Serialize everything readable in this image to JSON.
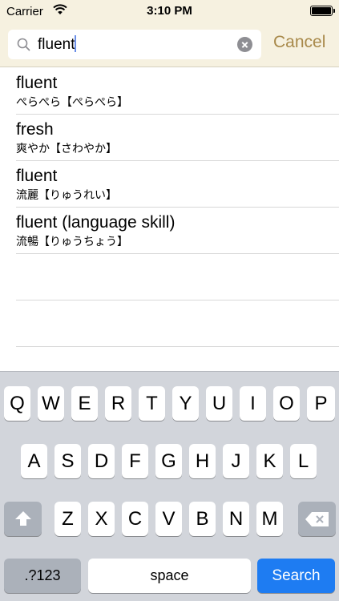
{
  "status_bar": {
    "carrier": "Carrier",
    "time": "3:10 PM",
    "wifi_icon": "wifi-icon",
    "battery_level": 1.0
  },
  "search": {
    "query": "fluent",
    "cancel_label": "Cancel"
  },
  "results": [
    {
      "english": "fluent",
      "japanese": "ぺらぺら【ぺらぺら】"
    },
    {
      "english": "fresh",
      "japanese": "爽やか【さわやか】"
    },
    {
      "english": "fluent",
      "japanese": "流麗【りゅうれい】"
    },
    {
      "english": "fluent (language skill)",
      "japanese": "流暢【りゅうちょう】"
    }
  ],
  "keyboard": {
    "row1": [
      "Q",
      "W",
      "E",
      "R",
      "T",
      "Y",
      "U",
      "I",
      "O",
      "P"
    ],
    "row2": [
      "A",
      "S",
      "D",
      "F",
      "G",
      "H",
      "J",
      "K",
      "L"
    ],
    "row3": [
      "Z",
      "X",
      "C",
      "V",
      "B",
      "N",
      "M"
    ],
    "numbers_label": ".?123",
    "space_label": "space",
    "search_label": "Search",
    "accent_color": "#1e7cf2"
  }
}
